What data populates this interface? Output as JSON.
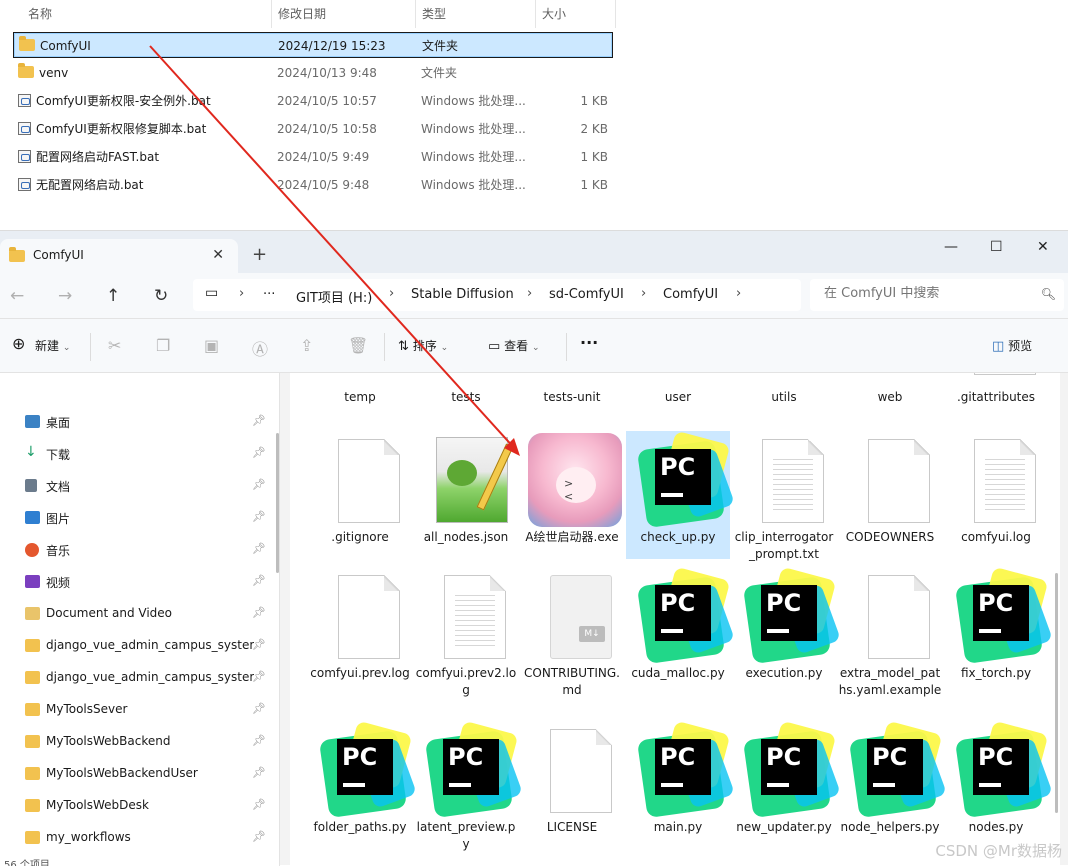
{
  "top_list": {
    "headers": {
      "name": "名称",
      "date": "修改日期",
      "type": "类型",
      "size": "大小"
    },
    "rows": [
      {
        "name": "ComfyUI",
        "date": "2024/12/19 15:23",
        "type": "文件夹",
        "size": "",
        "kind": "folder",
        "selected": true
      },
      {
        "name": "venv",
        "date": "2024/10/13 9:48",
        "type": "文件夹",
        "size": "",
        "kind": "folder"
      },
      {
        "name": "ComfyUI更新权限-安全例外.bat",
        "date": "2024/10/5 10:57",
        "type": "Windows 批处理...",
        "size": "1 KB",
        "kind": "bat"
      },
      {
        "name": "ComfyUI更新权限修复脚本.bat",
        "date": "2024/10/5 10:58",
        "type": "Windows 批处理...",
        "size": "2 KB",
        "kind": "bat"
      },
      {
        "name": "配置网络启动FAST.bat",
        "date": "2024/10/5 9:49",
        "type": "Windows 批处理...",
        "size": "1 KB",
        "kind": "bat"
      },
      {
        "name": "无配置网络启动.bat",
        "date": "2024/10/5 9:48",
        "type": "Windows 批处理...",
        "size": "1 KB",
        "kind": "bat"
      }
    ]
  },
  "window": {
    "tab_title": "ComfyUI",
    "breadcrumbs": [
      "GIT项目 (H:)",
      "Stable Diffusion",
      "sd-ComfyUI",
      "ComfyUI"
    ],
    "more": "···",
    "search_placeholder": "在 ComfyUI 中搜索",
    "toolbar": {
      "new": "新建",
      "sort": "排序",
      "view": "查看",
      "more": "···",
      "preview": "预览"
    }
  },
  "sidebar": {
    "items": [
      {
        "label": "桌面",
        "color": "#3b82c4"
      },
      {
        "label": "下载",
        "color": "#1e9e6a"
      },
      {
        "label": "文档",
        "color": "#6b7b8c"
      },
      {
        "label": "图片",
        "color": "#2f7fd1"
      },
      {
        "label": "音乐",
        "color": "#e4572e"
      },
      {
        "label": "视频",
        "color": "#7b3fbf"
      },
      {
        "label": "Document and Video",
        "color": "#e9c46a"
      },
      {
        "label": "django_vue_admin_campus_system_",
        "color": "#f2c24f"
      },
      {
        "label": "django_vue_admin_campus_system_",
        "color": "#f2c24f"
      },
      {
        "label": "MyToolsSever",
        "color": "#f2c24f"
      },
      {
        "label": "MyToolsWebBackend",
        "color": "#f2c24f"
      },
      {
        "label": "MyToolsWebBackendUser",
        "color": "#f2c24f"
      },
      {
        "label": "MyToolsWebDesk",
        "color": "#f2c24f"
      },
      {
        "label": "my_workflows",
        "color": "#f2c24f"
      }
    ],
    "status": "56 个项目"
  },
  "grid": {
    "row1": [
      {
        "label": "temp",
        "kind": "folder"
      },
      {
        "label": "tests",
        "kind": "folder"
      },
      {
        "label": "tests-unit",
        "kind": "folder"
      },
      {
        "label": "user",
        "kind": "folder"
      },
      {
        "label": "utils",
        "kind": "folder"
      },
      {
        "label": "web",
        "kind": "folder"
      },
      {
        "label": ".gitattributes",
        "kind": "doc"
      }
    ],
    "row2": [
      {
        "label": ".gitignore",
        "kind": "doc"
      },
      {
        "label": "all_nodes.json",
        "kind": "notepad"
      },
      {
        "label": "A绘世启动器.exe",
        "kind": "anime"
      },
      {
        "label": "check_up.py",
        "kind": "pc",
        "selected": true
      },
      {
        "label": "clip_interrogator_prompt.txt",
        "kind": "lines"
      },
      {
        "label": "CODEOWNERS",
        "kind": "doc"
      },
      {
        "label": "comfyui.log",
        "kind": "lines"
      }
    ],
    "row3": [
      {
        "label": "comfyui.prev.log",
        "kind": "doc"
      },
      {
        "label": "comfyui.prev2.log",
        "kind": "lines"
      },
      {
        "label": "CONTRIBUTING.md",
        "kind": "md"
      },
      {
        "label": "cuda_malloc.py",
        "kind": "pc"
      },
      {
        "label": "execution.py",
        "kind": "pc"
      },
      {
        "label": "extra_model_paths.yaml.example",
        "kind": "doc"
      },
      {
        "label": "fix_torch.py",
        "kind": "pc"
      }
    ],
    "row4": [
      {
        "label": "folder_paths.py",
        "kind": "pc"
      },
      {
        "label": "latent_preview.py",
        "kind": "pc"
      },
      {
        "label": "LICENSE",
        "kind": "doc"
      },
      {
        "label": "main.py",
        "kind": "pc"
      },
      {
        "label": "new_updater.py",
        "kind": "pc"
      },
      {
        "label": "node_helpers.py",
        "kind": "pc"
      },
      {
        "label": "nodes.py",
        "kind": "pc"
      }
    ]
  },
  "watermark": "CSDN @Mr数据杨",
  "colors": {
    "selection": "#cce8ff",
    "arrow": "#e0281e"
  }
}
